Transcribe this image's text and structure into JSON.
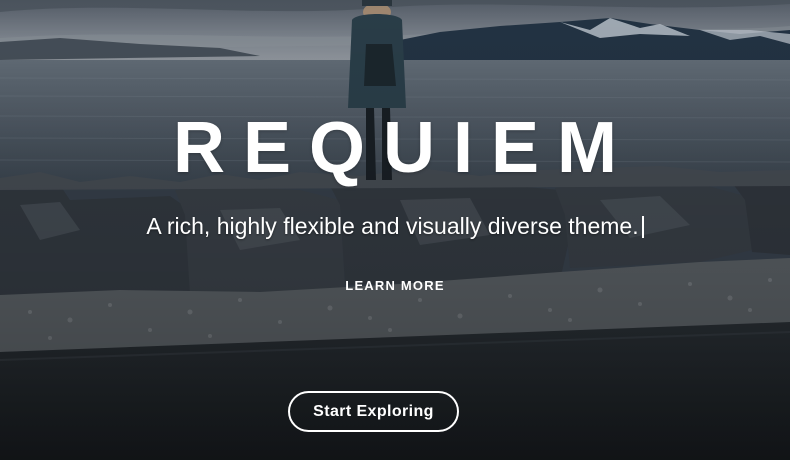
{
  "hero": {
    "title": "REQUIEM",
    "tagline": "A rich, highly flexible and visually diverse theme.",
    "learn_more_label": "LEARN MORE",
    "cta_label": "Start Exploring"
  },
  "colors": {
    "text": "#ffffff",
    "sky": "#6f7a86",
    "sea": "#47525e",
    "rocks": "#2f353c",
    "road": "#22272c"
  },
  "icons": {
    "text_cursor": "text-cursor-icon"
  }
}
